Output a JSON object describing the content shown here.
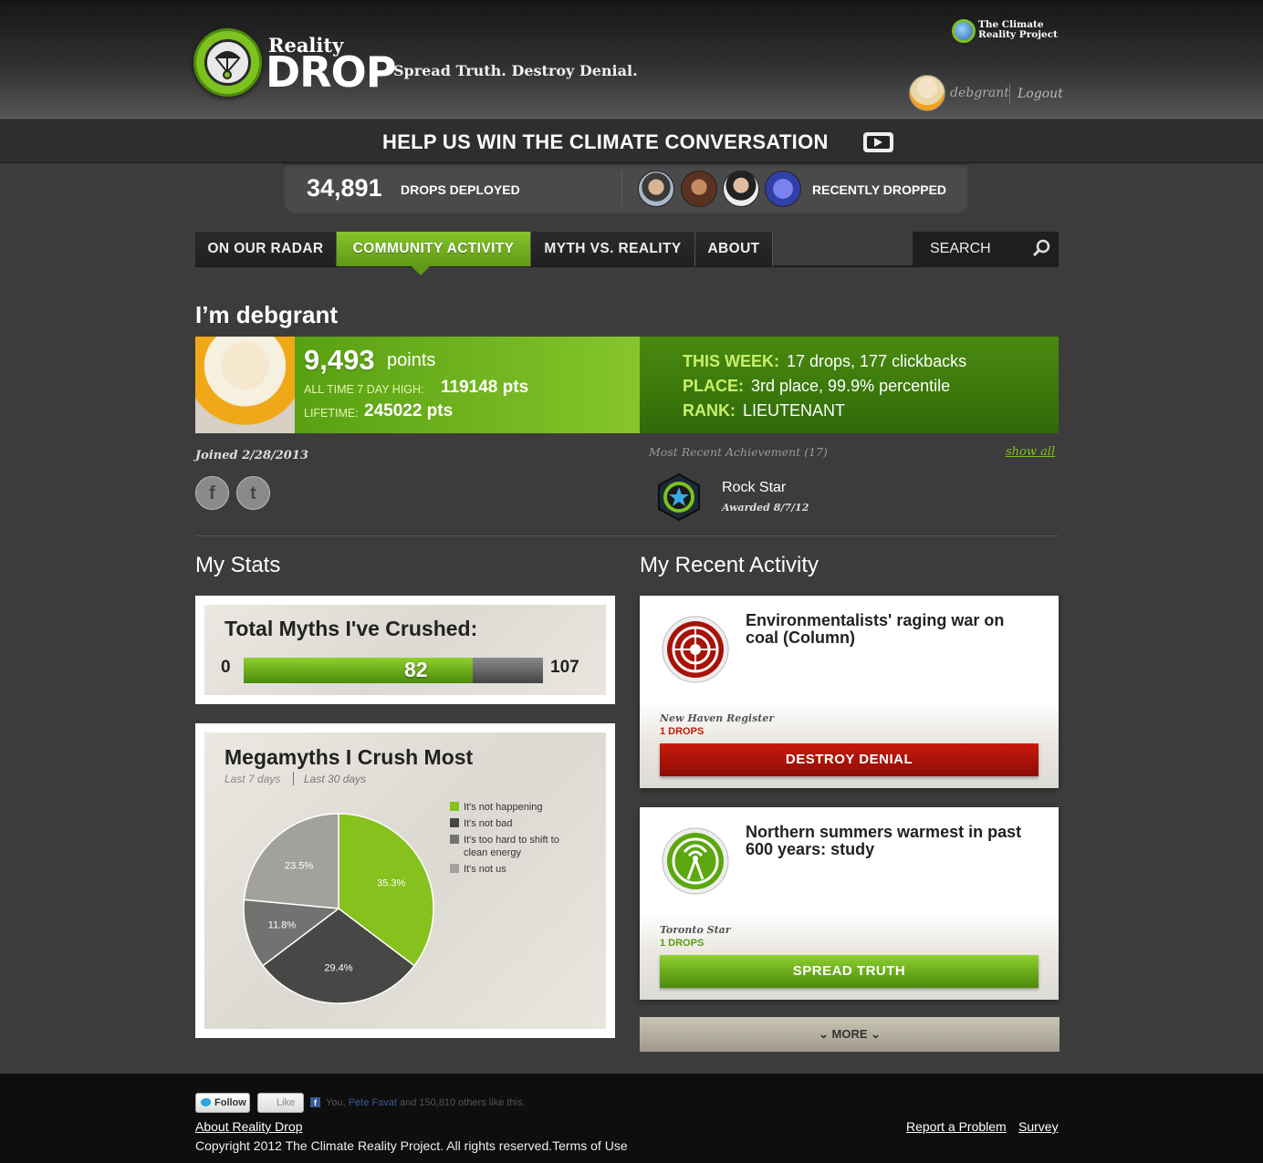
{
  "header": {
    "logo_reality": "Reality",
    "logo_drop": "DROP",
    "tagline": "Spread Truth. Destroy Denial.",
    "partner_logo_line1": "The Climate",
    "partner_logo_line2": "Reality Project",
    "username": "debgrant",
    "logout_label": "Logout"
  },
  "banner": {
    "title": "HELP US WIN THE CLIMATE CONVERSATION",
    "play_icon": "play-video-icon"
  },
  "stats_bar": {
    "drops_count": "34,891",
    "drops_label": "DROPS DEPLOYED",
    "recent_label": "RECENTLY DROPPED"
  },
  "nav": {
    "tabs": [
      {
        "label": "ON OUR RADAR"
      },
      {
        "label": "COMMUNITY ACTIVITY",
        "active": true
      },
      {
        "label": "MYTH VS. REALITY"
      },
      {
        "label": "ABOUT"
      }
    ],
    "search_label": "SEARCH",
    "search_icon": "search-icon"
  },
  "profile": {
    "title": "I’m debgrant",
    "points": "9,493",
    "points_unit": "points",
    "seven_day_high_label": "ALL TIME 7 DAY HIGH:",
    "seven_day_high_value": "119148 pts",
    "lifetime_label": "LIFETIME:",
    "lifetime_value": "245022 pts",
    "this_week_label": "THIS WEEK:",
    "this_week_value": "17 drops, 177 clickbacks",
    "place_label": "PLACE:",
    "place_value": "3rd place, 99.9% percentile",
    "rank_label": "RANK:",
    "rank_value": "LIEUTENANT",
    "joined": "Joined 2/28/2013",
    "facebook_glyph": "f",
    "twitter_glyph": "t",
    "achievement_title": "Most Recent Achievement (17)",
    "show_all": "show all",
    "achievement_name": "Rock Star",
    "achievement_date": "Awarded 8/7/12"
  },
  "stats": {
    "section_title": "My Stats",
    "myths_title": "Total Myths I've Crushed:",
    "myths_min": "0",
    "myths_max": "107",
    "myths_value": "82",
    "myths_fraction": 0.766,
    "megamyths_title": "Megamyths I Crush Most",
    "tab_7_days": "Last 7 days",
    "tab_30_days": "Last 30 days"
  },
  "chart_data": {
    "type": "pie",
    "title": "Megamyths I Crush Most",
    "series": [
      {
        "name": "It's not happening",
        "value": 35.3,
        "label": "35.3%",
        "color": "#86c11d"
      },
      {
        "name": "It's not bad",
        "value": 29.4,
        "label": "29.4%",
        "color": "#474745"
      },
      {
        "name": "It's too hard to shift to clean energy",
        "value": 11.8,
        "label": "11.8%",
        "color": "#727270"
      },
      {
        "name": "It's not us",
        "value": 23.5,
        "label": "23.5%",
        "color": "#a3a19c"
      }
    ]
  },
  "activity": {
    "section_title": "My Recent Activity",
    "items": [
      {
        "title": "Environmentalists' raging war on coal (Column)",
        "source": "New Haven Register",
        "drops": "1 DROPS",
        "button": "DESTROY DENIAL",
        "icon": "target-icon",
        "accent": "#c41a0c"
      },
      {
        "title": "Northern summers warmest in past 600 years: study",
        "source": "Toronto Star",
        "drops": "1 DROPS",
        "button": "SPREAD TRUTH",
        "icon": "broadcast-tower-icon",
        "accent": "#5a9a14"
      }
    ],
    "more_label": "MORE"
  },
  "footer": {
    "follow_label": "Follow",
    "like_label": "Like",
    "like_prefix": "You,",
    "like_friend": "Pete Favat",
    "like_suffix": "and 150,810 others like this.",
    "about_link": "About Reality Drop",
    "copyright": "Copyright 2012 The Climate Reality Project. All rights reserved.Terms of Use",
    "report_link": "Report a Problem",
    "survey_link": "Survey"
  },
  "colors": {
    "brand_green": "#7dc21e",
    "deny_red": "#c41a0c",
    "background": "#3c3c3c"
  }
}
